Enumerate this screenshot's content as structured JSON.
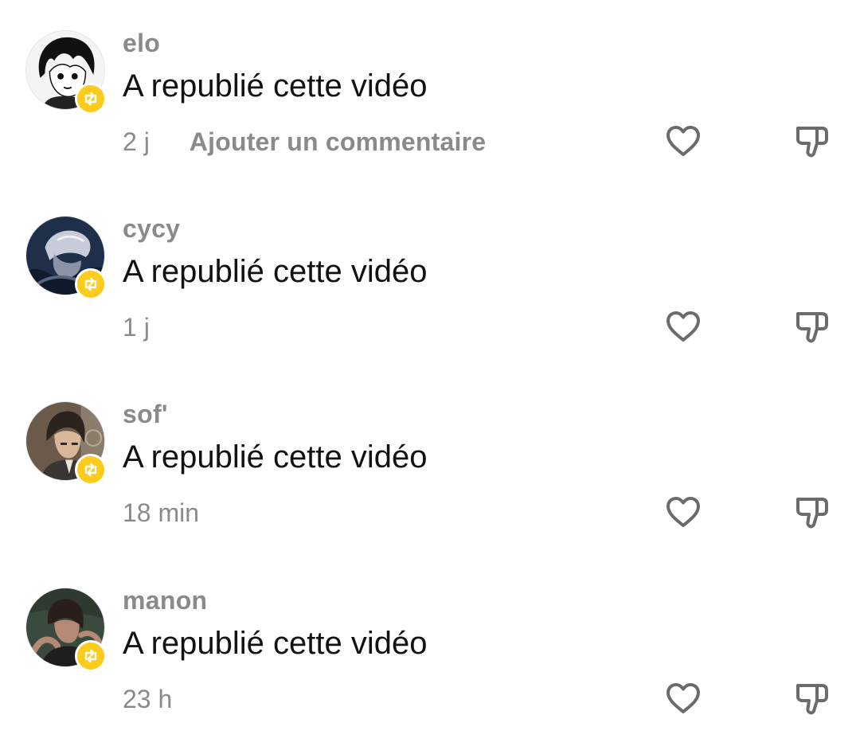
{
  "comments": [
    {
      "username": "elo",
      "message": "A republié cette vidéo",
      "timestamp": "2 j",
      "reply_label": "Ajouter un commentaire",
      "avatar_colors": [
        "#f4f4f4",
        "#111111"
      ]
    },
    {
      "username": "cycy",
      "message": "A republié cette vidéo",
      "timestamp": "1 j",
      "avatar_colors": [
        "#1f2f4a",
        "#c8ccd8"
      ]
    },
    {
      "username": "sof'",
      "message": "A republié cette vidéo",
      "timestamp": "18 min",
      "avatar_colors": [
        "#6b5a4a",
        "#2b231e"
      ]
    },
    {
      "username": "manon",
      "message": "A republié cette vidéo",
      "timestamp": "23 h",
      "avatar_colors": [
        "#3a4a3c",
        "#2a1e1a"
      ]
    }
  ],
  "icons": {
    "repost": "repost-icon",
    "like": "heart-icon",
    "dislike": "thumbs-down-icon"
  },
  "colors": {
    "badge": "#fccb1c",
    "muted_text": "#8a8a8a",
    "text": "#121212"
  }
}
